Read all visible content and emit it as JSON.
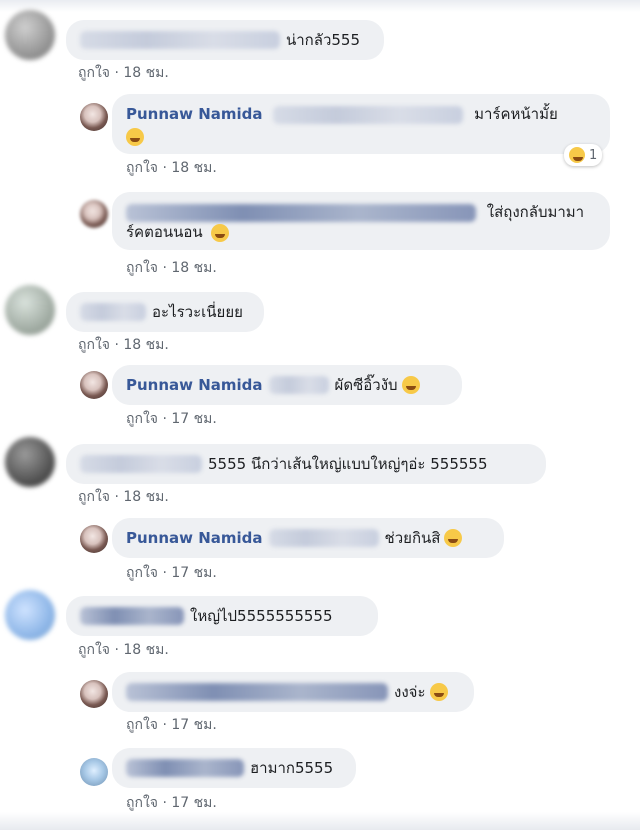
{
  "comments": [
    {
      "text": "น่ากลัว555",
      "like": "ถูกใจ",
      "dot": "·",
      "time": "18 ชม."
    },
    {
      "name": "Punnaw Namida",
      "text": "มาร์คหน้ามั้ย",
      "like": "ถูกใจ",
      "dot": "·",
      "time": "18 ชม.",
      "reaction_count": "1"
    },
    {
      "text_line1": "ใส่ถุงกลับมามา",
      "text_line2": "ร์คตอนนอน",
      "like": "ถูกใจ",
      "dot": "·",
      "time": "18 ชม."
    },
    {
      "text": "อะไรวะเนี่ยยย",
      "like": "ถูกใจ",
      "dot": "·",
      "time": "18 ชม."
    },
    {
      "name": "Punnaw Namida",
      "text": "ผัดซีอิ๊วงับ",
      "like": "ถูกใจ",
      "dot": "·",
      "time": "17 ชม."
    },
    {
      "text": "5555 นึกว่าเส้นใหญ่แบบใหญ่ๆอ่ะ 555555",
      "like": "ถูกใจ",
      "dot": "·",
      "time": "18 ชม."
    },
    {
      "name": "Punnaw Namida",
      "text": "ช่วยกินสิ",
      "like": "ถูกใจ",
      "dot": "·",
      "time": "17 ชม."
    },
    {
      "text": "ใหญ่ไป5555555555",
      "like": "ถูกใจ",
      "dot": "·",
      "time": "18 ชม."
    },
    {
      "text": "งงจ่ะ",
      "like": "ถูกใจ",
      "dot": "·",
      "time": "17 ชม."
    },
    {
      "text": "ฮามาก5555",
      "like": "ถูกใจ",
      "dot": "·",
      "time": "17 ชม."
    }
  ],
  "icons": {
    "emoji": "laughing-emoji-icon",
    "reaction": "haha-reaction-icon"
  },
  "colors": {
    "bubble": "#eef0f3",
    "name": "#385898",
    "meta": "#606770"
  }
}
